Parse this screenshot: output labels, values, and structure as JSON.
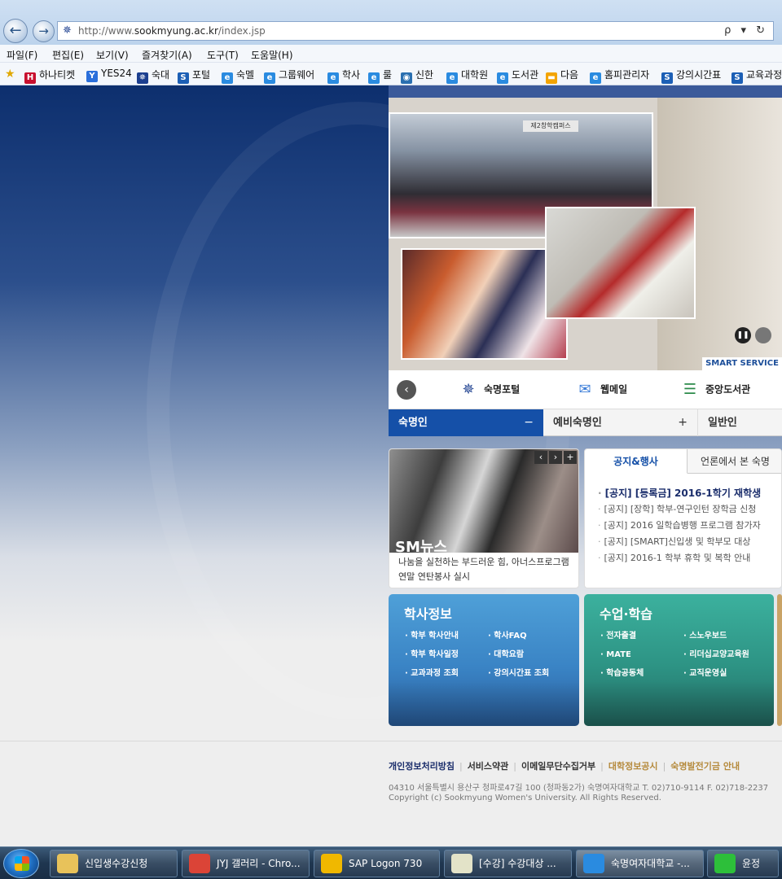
{
  "browser": {
    "back_icon": "back-arrow-icon",
    "forward_icon": "forward-arrow-icon",
    "url_prefix": "http://www.",
    "url_domain": "sookmyung.ac.kr",
    "url_path": "/index.jsp",
    "url_tools": "ρ ▾ ↻"
  },
  "menu": [
    "파일(F)",
    "편집(E)",
    "보기(V)",
    "즐겨찾기(A)",
    "도구(T)",
    "도움말(H)"
  ],
  "favorites": [
    {
      "label": "하나티켓",
      "icon": "H",
      "color": "#c8102e"
    },
    {
      "label": "YES24",
      "icon": "Y",
      "color": "#2a6fdb"
    },
    {
      "label": "숙대",
      "icon": "✵",
      "color": "#1c3f8f"
    },
    {
      "label": "포털",
      "icon": "S",
      "color": "#1c5fb5"
    },
    {
      "label": "숙멜",
      "icon": "e",
      "color": "#2a8be0"
    },
    {
      "label": "그룹웨어",
      "icon": "e",
      "color": "#2a8be0"
    },
    {
      "label": "학사",
      "icon": "e",
      "color": "#2a8be0"
    },
    {
      "label": "룰",
      "icon": "e",
      "color": "#2a8be0"
    },
    {
      "label": "신한",
      "icon": "◉",
      "color": "#2a6fb0"
    },
    {
      "label": "대학원",
      "icon": "e",
      "color": "#2a8be0"
    },
    {
      "label": "도서관",
      "icon": "e",
      "color": "#2a8be0"
    },
    {
      "label": "다음",
      "icon": "▬",
      "color": "#f3a400"
    },
    {
      "label": "홈피관리자",
      "icon": "e",
      "color": "#2a8be0"
    },
    {
      "label": "강의시간표",
      "icon": "S",
      "color": "#1c5fb5"
    },
    {
      "label": "교육과정",
      "icon": "S",
      "color": "#1c5fb5"
    }
  ],
  "hero": {
    "sign_text": "제2창학캠퍼스",
    "smart_service": "SMART SERVICE"
  },
  "quicklinks": [
    {
      "label": "숙명포털",
      "icon": "star-emblem-icon",
      "glyph": "✵",
      "color": "#1c3f8f"
    },
    {
      "label": "웹메일",
      "icon": "envelope-icon",
      "glyph": "✉",
      "color": "#3b7dd8"
    },
    {
      "label": "중앙도서관",
      "icon": "books-icon",
      "glyph": "☰",
      "color": "#2b8a4a"
    }
  ],
  "tabs": [
    {
      "label": "숙명인",
      "sign": "−"
    },
    {
      "label": "예비숙명인",
      "sign": "+"
    },
    {
      "label": "일반인",
      "sign": ""
    }
  ],
  "news": {
    "label": "SM뉴스",
    "caption": "나눔을 실천하는 부드러운 힘, 아너스프로그램 연말 연탄봉사 실시",
    "controls": [
      "‹",
      "›",
      "+"
    ]
  },
  "notice": {
    "tabs": [
      "공지&행사",
      "언론에서 본 숙명"
    ],
    "items": [
      "[공지] [등록금] 2016-1학기 재학생",
      "[공지] [장학] 학부-연구인턴 장학금 신청",
      "[공지] 2016 일학습병행 프로그램 참가자",
      "[공지] [SMART]신입생 및 학부모 대상",
      "[공지] 2016-1 학부 휴학 및 복학 안내"
    ]
  },
  "haksa": {
    "title": "학사정보",
    "col1": [
      "학부 학사안내",
      "학부 학사일정",
      "교과과정 조회"
    ],
    "col2": [
      "학사FAQ",
      "대학요람",
      "강의시간표 조회"
    ]
  },
  "study": {
    "title": "수업·학습",
    "col1": [
      "전자출결",
      "MATE",
      "학습공동체"
    ],
    "col2": [
      "스노우보드",
      "리더십교양교육원",
      "교직운영실"
    ]
  },
  "footer": {
    "links": [
      "개인정보처리방침",
      "서비스약관",
      "이메일무단수집거부",
      "대학정보공시",
      "숙명발전기금 안내"
    ],
    "address": "04310 서울특별시 용산구 청파로47길 100 (청파동2가) 숙명여자대학교   T. 02)710-9114  F. 02)718-2237",
    "copyright": "Copyright (c) Sookmyung Women's University. All Rights Reserved."
  },
  "taskbar": [
    {
      "label": "신입생수강신청",
      "icon": "folder-icon",
      "color": "#e8c25a"
    },
    {
      "label": "JYJ 갤러리 - Chro...",
      "icon": "chrome-icon",
      "color": "#db4437"
    },
    {
      "label": "SAP Logon 730",
      "icon": "sap-icon",
      "color": "#f0b800"
    },
    {
      "label": "[수강] 수강대상 ...",
      "icon": "window-icon",
      "color": "#e3e3c8"
    },
    {
      "label": "숙명여자대학교 -...",
      "icon": "ie-icon",
      "color": "#2a8be0"
    },
    {
      "label": "윤정",
      "icon": "contact-icon",
      "color": "#2dbf3a"
    }
  ]
}
